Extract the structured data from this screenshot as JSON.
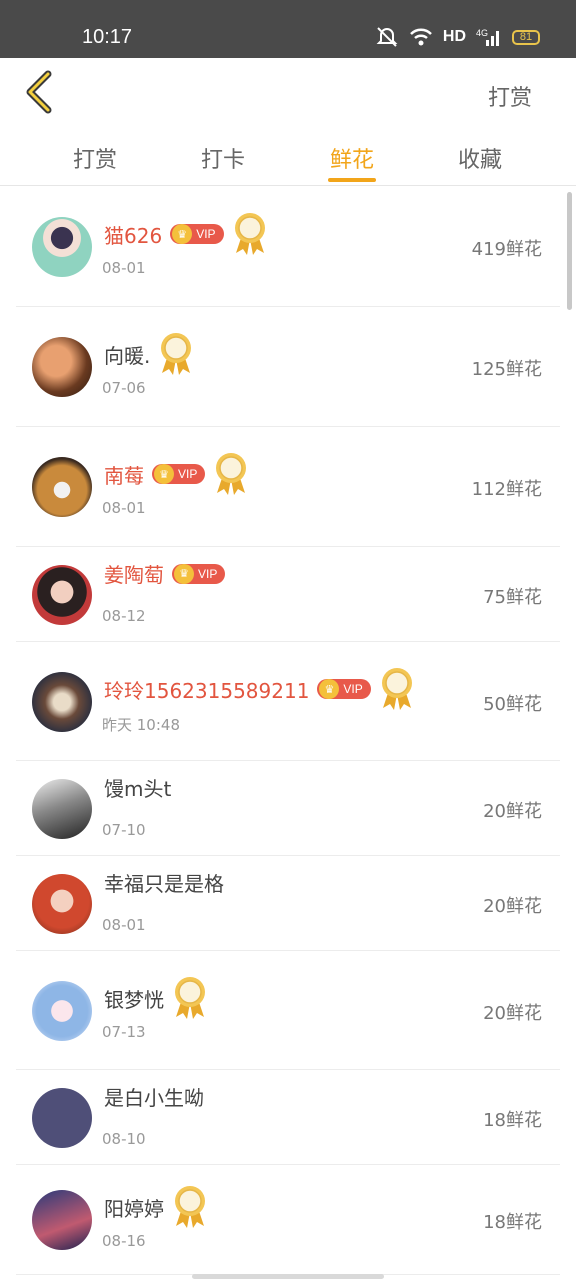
{
  "status_bar": {
    "time": "10:17",
    "network": "HD",
    "signal_label": "4G",
    "battery": "81"
  },
  "header": {
    "action": "打赏"
  },
  "tabs": [
    {
      "label": "打赏",
      "active": false
    },
    {
      "label": "打卡",
      "active": false
    },
    {
      "label": "鲜花",
      "active": true
    },
    {
      "label": "收藏",
      "active": false
    }
  ],
  "vip_label": "VIP",
  "rows": [
    {
      "name": "猫626",
      "date": "08-01",
      "flowers": "419鲜花",
      "vip": true,
      "medal": true
    },
    {
      "name": "向暖.",
      "date": "07-06",
      "flowers": "125鲜花",
      "vip": false,
      "medal": true
    },
    {
      "name": "南莓",
      "date": "08-01",
      "flowers": "112鲜花",
      "vip": true,
      "medal": true
    },
    {
      "name": "姜陶萄",
      "date": "08-12",
      "flowers": "75鲜花",
      "vip": true,
      "medal": false
    },
    {
      "name": "玲玲1562315589211",
      "date": "昨天  10:48",
      "flowers": "50鲜花",
      "vip": true,
      "medal": true
    },
    {
      "name": "馒m头t",
      "date": "07-10",
      "flowers": "20鲜花",
      "vip": false,
      "medal": false
    },
    {
      "name": "幸福只是是格",
      "date": "08-01",
      "flowers": "20鲜花",
      "vip": false,
      "medal": false
    },
    {
      "name": "银梦恍",
      "date": "07-13",
      "flowers": "20鲜花",
      "vip": false,
      "medal": true
    },
    {
      "name": "是白小生呦",
      "date": "08-10",
      "flowers": "18鲜花",
      "vip": false,
      "medal": false
    },
    {
      "name": "阳婷婷",
      "date": "08-16",
      "flowers": "18鲜花",
      "vip": false,
      "medal": true
    }
  ],
  "colors": {
    "accent": "#f2a51a",
    "vip_name": "#e2553f",
    "vip_badge": "#e8594a",
    "status_bar": "#4a4a4a"
  }
}
